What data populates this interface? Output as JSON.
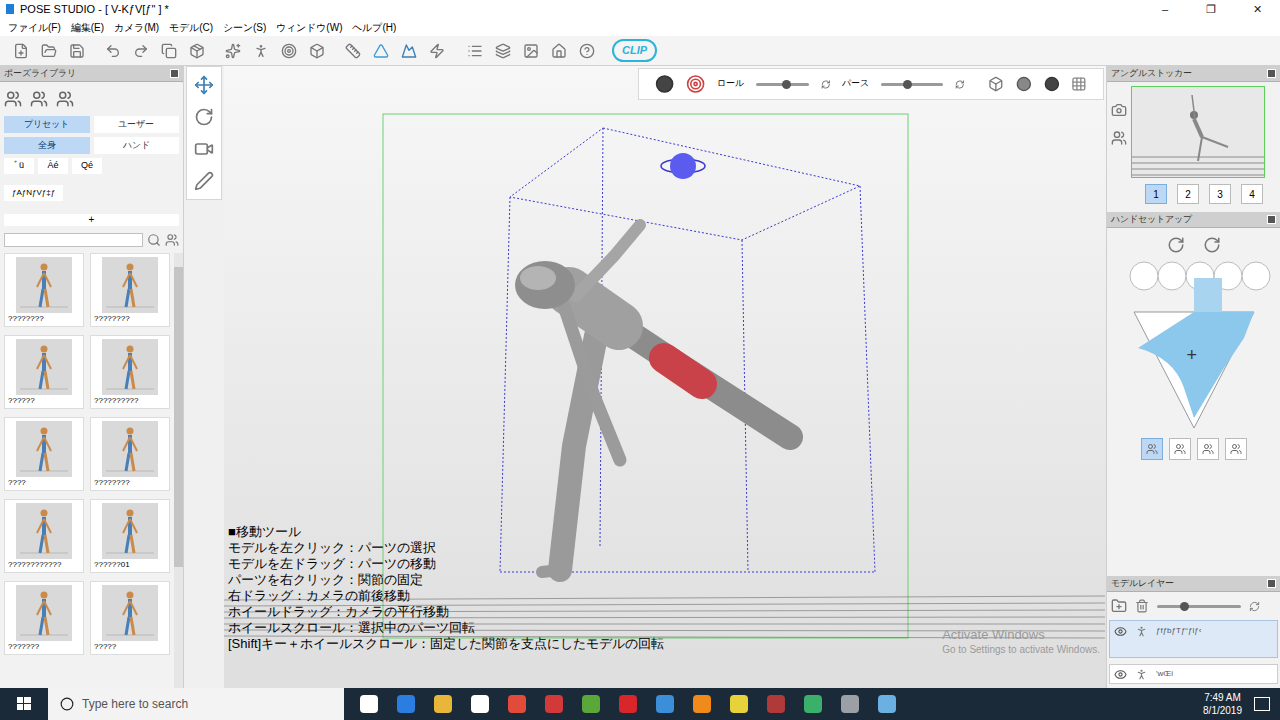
{
  "window": {
    "title": "POSE STUDIO  - [ V-KƒV[ƒ\" ] *",
    "controls": [
      "–",
      "❐",
      "✕"
    ]
  },
  "menu": [
    "ファイル(F)",
    "編集(E)",
    "カメラ(M)",
    "モデル(C)",
    "シーン(S)",
    "ウィンドウ(W)",
    "ヘルプ(H)"
  ],
  "toolbar": {
    "logo": "CLIP"
  },
  "pose_library": {
    "title": "ポーズライブラリ",
    "source_tabs": [
      {
        "label": "プリセット",
        "selected": true
      },
      {
        "label": "ユーザー",
        "selected": false
      }
    ],
    "type_tabs": [
      {
        "label": "全身",
        "selected": true
      },
      {
        "label": "ハンド",
        "selected": false
      }
    ],
    "filters": [
      "ﾞü",
      "Àé",
      "Qé"
    ],
    "category": "ƒAƒNƒVƒ‡ƒ",
    "add": "+",
    "thumbnails": [
      {
        "label": "????????"
      },
      {
        "label": "????????"
      },
      {
        "label": "??????"
      },
      {
        "label": "??????????"
      },
      {
        "label": "????"
      },
      {
        "label": "????????"
      },
      {
        "label": "????????????"
      },
      {
        "label": "??????01"
      },
      {
        "label": "???????"
      },
      {
        "label": "?????"
      }
    ]
  },
  "viewport": {
    "camera_bar": {
      "roll_label": "ロール",
      "roll_level": 0.5,
      "perspective_label": "パース",
      "perspective_level": 0.35
    },
    "help": [
      "■移動ツール",
      "モデルを左クリック：パーツの選択",
      "モデルを左ドラッグ：パーツの移動",
      "パーツを右クリック：関節の固定",
      "右ドラッグ：カメラの前後移動",
      "ホイールドラッグ：カメラの平行移動",
      "ホイールスクロール：選択中のパーツ回転",
      "[Shift]キー＋ホイールスクロール：固定した関節を支点にしたモデルの回転"
    ]
  },
  "angle_stocker": {
    "title": "アングルストッカー",
    "slots": [
      {
        "label": "1",
        "selected": true
      },
      {
        "label": "2",
        "selected": false
      },
      {
        "label": "3",
        "selected": false
      },
      {
        "label": "4",
        "selected": false
      }
    ]
  },
  "hand_setup": {
    "title": "ハンドセットアップ",
    "center_mark": "+",
    "presets": [
      {
        "selected": true
      },
      {
        "selected": false
      },
      {
        "selected": false
      },
      {
        "selected": false
      }
    ]
  },
  "model_layer": {
    "title": "モデルレイヤー",
    "opacity_level": 0.3,
    "layers": [
      {
        "label": "ƒfƒbƒTƒ“ƒlƒ‹",
        "visible": true,
        "selected": true
      },
      {
        "label": "'wŒi",
        "visible": true,
        "selected": false
      }
    ]
  },
  "watermark": {
    "title": "Activate Windows",
    "subtitle": "Go to Settings to activate Windows."
  },
  "taskbar": {
    "search_placeholder": "Type here to search",
    "time": "7:49 AM",
    "date": "8/1/2019"
  }
}
